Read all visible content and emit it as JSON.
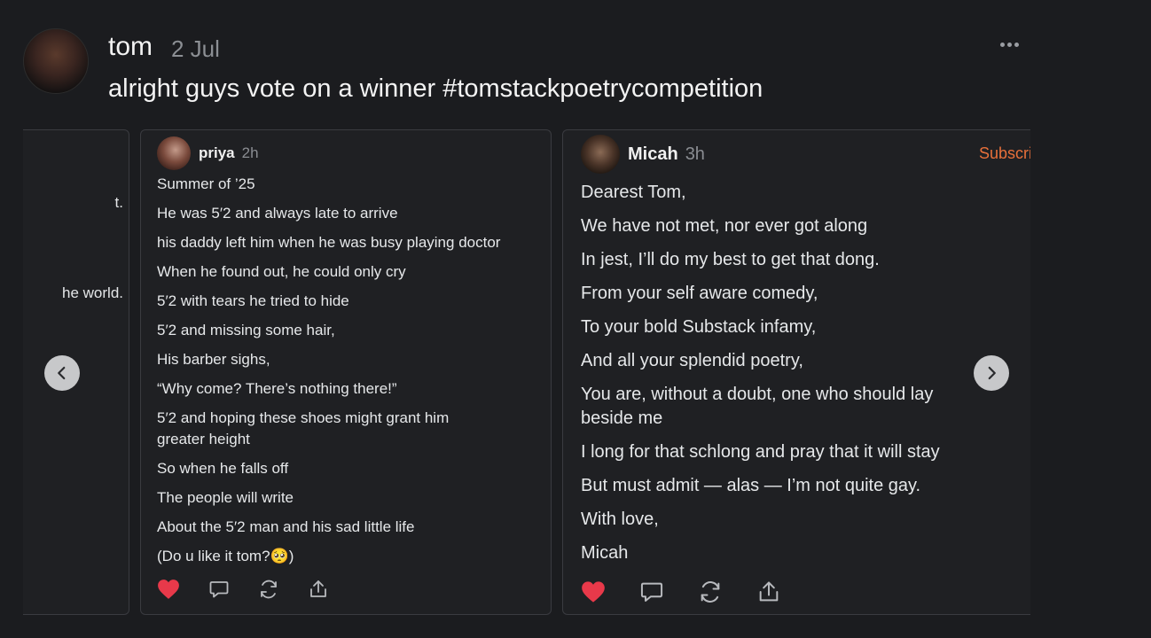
{
  "post": {
    "author": "tom",
    "date": "2 Jul",
    "text": "alright guys vote on a winner #tomstackpoetrycompetition"
  },
  "left_card": {
    "fragment_1": "t.",
    "fragment_2": "he world."
  },
  "priya_card": {
    "author": "priya",
    "time": "2h",
    "lines": [
      "Summer of ’25",
      "He was 5′2 and always late to arrive",
      "his daddy left him when he was busy playing doctor",
      "When he found out, he could only cry",
      "5′2 with tears he tried to hide",
      "5′2 and missing some hair,",
      "His barber sighs,",
      " “Why come? There’s nothing there!”",
      "5′2 and hoping these shoes might grant him",
      "greater height",
      "So when he falls off",
      "The people will write",
      "About the 5′2 man and his sad little life",
      "(Do u like it tom?🥺)"
    ]
  },
  "micah_card": {
    "author": "Micah",
    "time": "3h",
    "subscribe_label": "Subscribe",
    "lines": [
      "Dearest Tom,",
      "We have not met, nor ever got along",
      "In jest, I’ll do my best to get that dong.",
      "From your self aware comedy,",
      "To your bold Substack infamy,",
      "And all your splendid poetry,",
      "You are, without a doubt, one who should lay",
      "beside me",
      "I long for that schlong and pray that it will stay",
      "But must admit — alas — I’m not quite gay.",
      "With love,",
      "Micah"
    ]
  },
  "colors": {
    "background": "#1b1c1f",
    "accent": "#e8703a",
    "like": "#e8394a"
  },
  "icons": [
    "more-icon",
    "heart-icon",
    "comment-icon",
    "restack-icon",
    "share-icon",
    "chevron-left-icon",
    "chevron-right-icon"
  ]
}
